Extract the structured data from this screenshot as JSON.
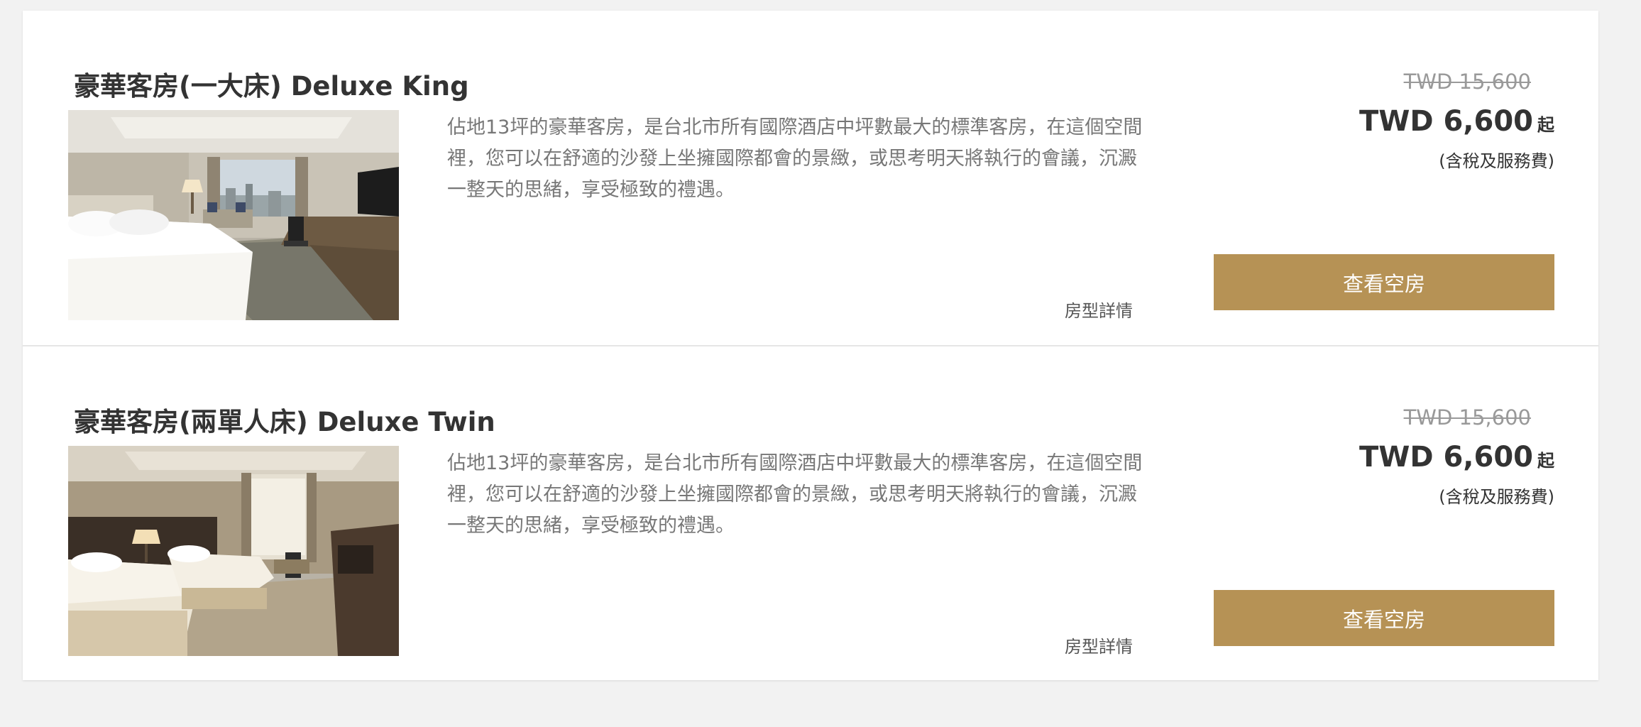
{
  "rooms": [
    {
      "title": "豪華客房(一大床) Deluxe King",
      "photo": "deluxe-king-room-photo",
      "description": "佔地13坪的豪華客房，是台北市所有國際酒店中坪數最大的標準客房，在這個空間裡，您可以在舒適的沙發上坐擁國際都會的景緻，或思考明天將執行的會議，沉澱一整天的思緒，享受極致的禮遇。",
      "details_link": "房型詳情",
      "original_price": "TWD 15,600",
      "price": "TWD 6,600",
      "price_suffix": "起",
      "price_note": "(含稅及服務費)",
      "button_label": "查看空房"
    },
    {
      "title": "豪華客房(兩單人床) Deluxe Twin",
      "photo": "deluxe-twin-room-photo",
      "description": "佔地13坪的豪華客房，是台北市所有國際酒店中坪數最大的標準客房，在這個空間裡，您可以在舒適的沙發上坐擁國際都會的景緻，或思考明天將執行的會議，沉澱一整天的思緒，享受極致的禮遇。",
      "details_link": "房型詳情",
      "original_price": "TWD 15,600",
      "price": "TWD 6,600",
      "price_suffix": "起",
      "price_note": "(含稅及服務費)",
      "button_label": "查看空房"
    }
  ],
  "colors": {
    "page_background": "#f2f2f2",
    "card_background": "#ffffff",
    "button_gold": "#b69255",
    "title_text": "#333333",
    "description_text": "#777777",
    "strikethrough_price": "#999999"
  }
}
